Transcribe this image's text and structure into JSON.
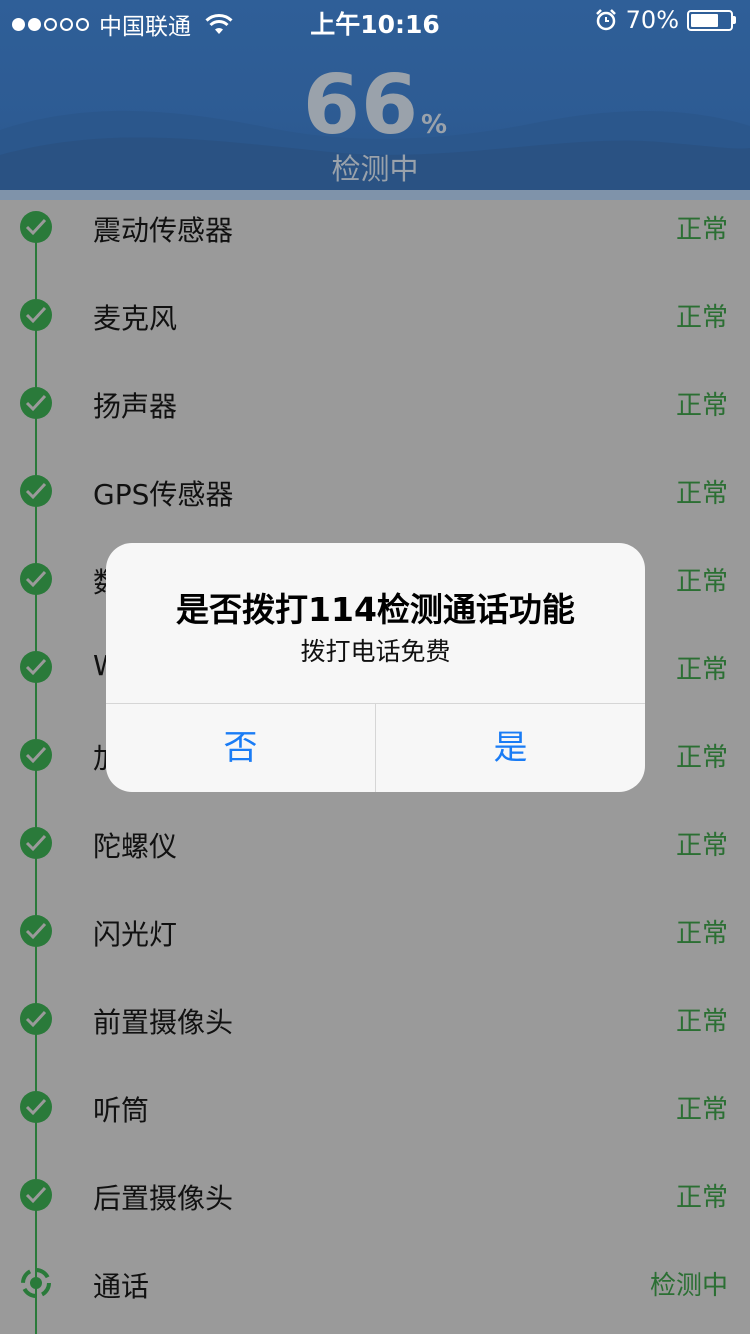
{
  "status_bar": {
    "carrier": "中国联通",
    "time": "上午10:16",
    "battery": "70%",
    "battery_level": 0.7
  },
  "header": {
    "progress_value": "66",
    "progress_unit": "%",
    "status": "检测中"
  },
  "items": [
    {
      "name": "震动传感器",
      "state": "正常"
    },
    {
      "name": "麦克风",
      "state": "正常"
    },
    {
      "name": "扬声器",
      "state": "正常"
    },
    {
      "name": "GPS传感器",
      "state": "正常"
    },
    {
      "name": "数",
      "state": "正常"
    },
    {
      "name": "W",
      "state": "正常"
    },
    {
      "name": "加",
      "state": "正常"
    },
    {
      "name": "陀螺仪",
      "state": "正常"
    },
    {
      "name": "闪光灯",
      "state": "正常"
    },
    {
      "name": "前置摄像头",
      "state": "正常"
    },
    {
      "name": "听筒",
      "state": "正常"
    },
    {
      "name": "后置摄像头",
      "state": "正常"
    },
    {
      "name": "通话",
      "state": "检测中"
    }
  ],
  "dialog": {
    "title": "是否拨打114检测通话功能",
    "message": "拨打电话免费",
    "no_label": "否",
    "yes_label": "是"
  },
  "colors": {
    "accent_green": "#2a7a3a",
    "ok_text": "#2b6f33",
    "dialog_button": "#1a7cf5",
    "header_blue": "#2f5f98"
  }
}
